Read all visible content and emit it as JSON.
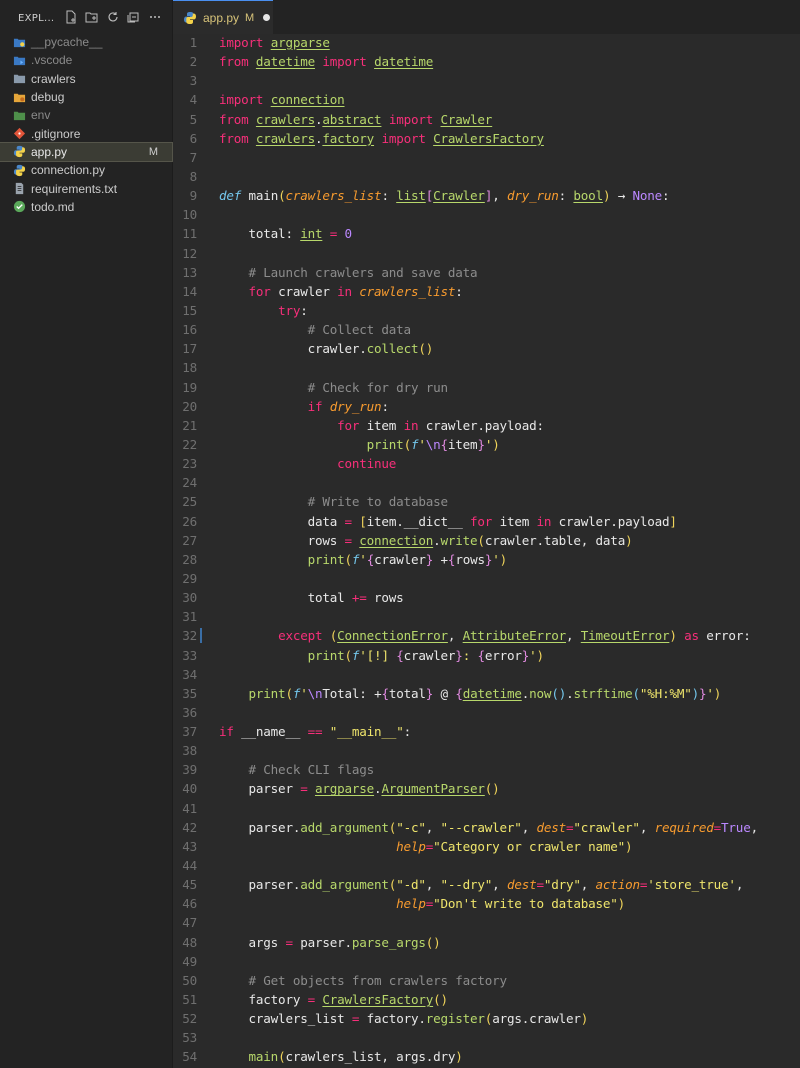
{
  "explorer": {
    "title": "EXPL...",
    "actions": [
      "new-file-icon",
      "new-folder-icon",
      "refresh-icon",
      "collapse-icon",
      "more-icon"
    ],
    "items": [
      {
        "label": "__pycache__",
        "icon": "folder-python-icon",
        "dim": true
      },
      {
        "label": ".vscode",
        "icon": "folder-vscode-icon",
        "dim": true
      },
      {
        "label": "crawlers",
        "icon": "folder-icon",
        "dim": false
      },
      {
        "label": "debug",
        "icon": "folder-debug-icon",
        "dim": false
      },
      {
        "label": "env",
        "icon": "folder-env-icon",
        "dim": true
      },
      {
        "label": ".gitignore",
        "icon": "git-icon",
        "dim": false
      },
      {
        "label": "app.py",
        "icon": "python-icon",
        "dim": false,
        "selected": true,
        "badge": "M"
      },
      {
        "label": "connection.py",
        "icon": "python-icon",
        "dim": false
      },
      {
        "label": "requirements.txt",
        "icon": "text-file-icon",
        "dim": false
      },
      {
        "label": "todo.md",
        "icon": "markdown-icon",
        "dim": false
      }
    ]
  },
  "tab": {
    "name": "app.py",
    "status": "M"
  },
  "editor": {
    "lines": [
      "1",
      "2",
      "3",
      "4",
      "5",
      "6",
      "7",
      "8",
      "9",
      "10",
      "11",
      "12",
      "13",
      "14",
      "15",
      "16",
      "17",
      "18",
      "19",
      "20",
      "21",
      "22",
      "23",
      "24",
      "25",
      "26",
      "27",
      "28",
      "29",
      "30",
      "31",
      "32",
      "33",
      "34",
      "35",
      "36",
      "37",
      "38",
      "39",
      "40",
      "41",
      "42",
      "43",
      "44",
      "45",
      "46",
      "47",
      "48",
      "49",
      "50",
      "51",
      "52",
      "53",
      "54"
    ]
  },
  "colors": {
    "accent": "#f72f7a",
    "green": "#b8d86b",
    "orange": "#f79b2f",
    "string": "#efe56c",
    "purple": "#bb88ff"
  }
}
